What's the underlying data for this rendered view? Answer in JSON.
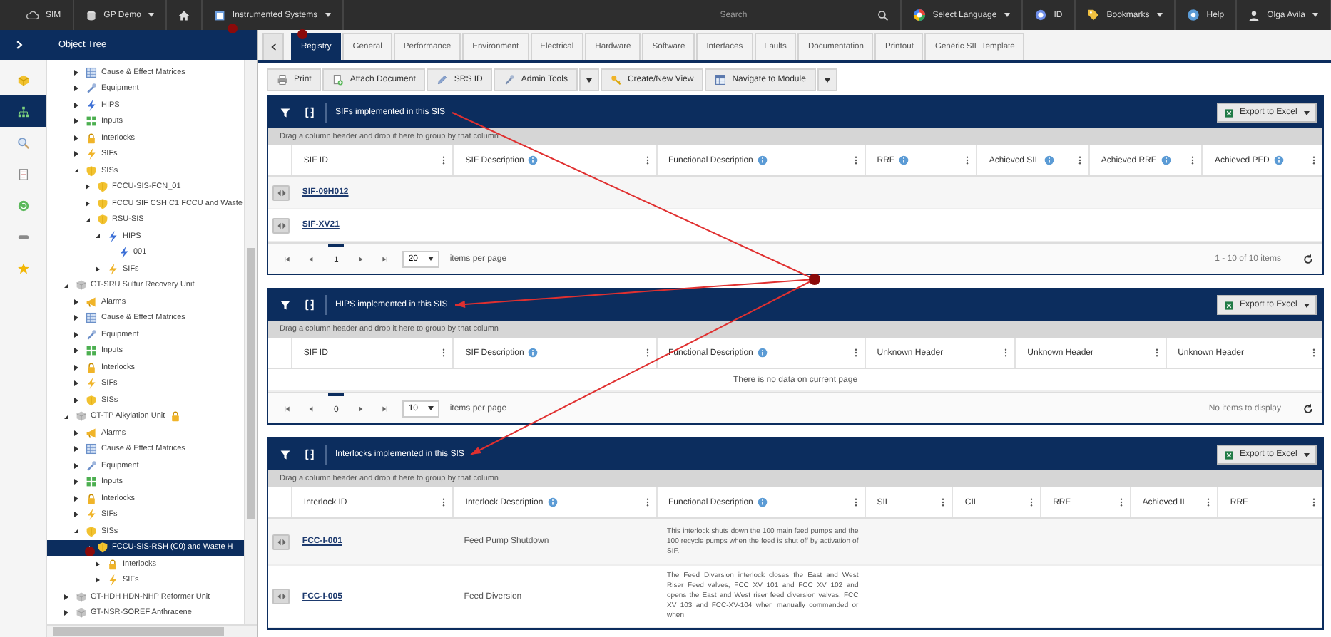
{
  "top_bar": {
    "app": "SIM",
    "site": "GP Demo",
    "module": "Instrumented Systems",
    "search": {
      "placeholder": "Search"
    },
    "language": "Select Language",
    "id_label": "ID",
    "bookmarks": "Bookmarks",
    "help": "Help",
    "user": "Olga Avila"
  },
  "rail": [
    {
      "kind": "cube",
      "selected": false
    },
    {
      "kind": "hierarchy",
      "selected": true
    },
    {
      "kind": "search",
      "selected": false
    },
    {
      "kind": "document",
      "selected": false
    },
    {
      "kind": "refresh",
      "selected": false
    },
    {
      "kind": "pill",
      "selected": false
    },
    {
      "kind": "star",
      "selected": false
    }
  ],
  "tree": {
    "title": "Object Tree",
    "continued": [
      {
        "label": "Cause & Effect Matrices",
        "kind": "matrix",
        "expanded": false
      },
      {
        "label": "Equipment",
        "kind": "wrench",
        "expanded": false
      },
      {
        "label": "HIPS",
        "kind": "hips",
        "expanded": false
      },
      {
        "label": "Inputs",
        "kind": "inputs",
        "expanded": false
      },
      {
        "label": "Interlocks",
        "kind": "lock",
        "expanded": false
      },
      {
        "label": "SIFs",
        "kind": "sif",
        "expanded": false
      },
      {
        "label": "SISs",
        "kind": "sis",
        "expanded": true,
        "children": [
          {
            "label": "FCCU-SIS-FCN_01",
            "kind": "sis",
            "expanded": false
          },
          {
            "label": "FCCU SIF CSH C1 FCCU and Waste",
            "kind": "sis",
            "expanded": false
          },
          {
            "label": "RSU-SIS",
            "kind": "sis",
            "expanded": true,
            "children": [
              {
                "label": "HIPS",
                "kind": "hips",
                "expanded": true,
                "children": [
                  {
                    "label": "001",
                    "kind": "hips"
                  }
                ]
              },
              {
                "label": "SIFs",
                "kind": "sif",
                "expanded": false
              }
            ]
          }
        ]
      }
    ],
    "items": [
      {
        "label": "GT-SRU Sulfur Recovery Unit",
        "kind": "cube",
        "expanded": true,
        "locked": false,
        "children": [
          {
            "label": "Alarms",
            "kind": "alarm",
            "expanded": false
          },
          {
            "label": "Cause & Effect Matrices",
            "kind": "matrix",
            "expanded": false
          },
          {
            "label": "Equipment",
            "kind": "wrench",
            "expanded": false
          },
          {
            "label": "Inputs",
            "kind": "inputs",
            "expanded": false
          },
          {
            "label": "Interlocks",
            "kind": "lock",
            "expanded": false
          },
          {
            "label": "SIFs",
            "kind": "sif",
            "expanded": false
          },
          {
            "label": "SISs",
            "kind": "sis",
            "expanded": false
          }
        ]
      },
      {
        "label": "GT-TP Alkylation Unit",
        "kind": "cube",
        "expanded": true,
        "locked": true,
        "children": [
          {
            "label": "Alarms",
            "kind": "alarm",
            "expanded": false
          },
          {
            "label": "Cause & Effect Matrices",
            "kind": "matrix",
            "expanded": false
          },
          {
            "label": "Equipment",
            "kind": "wrench",
            "expanded": false
          },
          {
            "label": "Inputs",
            "kind": "inputs",
            "expanded": false
          },
          {
            "label": "Interlocks",
            "kind": "lock",
            "expanded": false
          },
          {
            "label": "SIFs",
            "kind": "sif",
            "expanded": false
          },
          {
            "label": "SISs",
            "kind": "sis",
            "expanded": true,
            "children": [
              {
                "label": "FCCU-SIS-RSH (C0) and Waste H",
                "kind": "sis",
                "expanded": true,
                "selected": true,
                "children": [
                  {
                    "label": "Interlocks",
                    "kind": "lock",
                    "expanded": false
                  },
                  {
                    "label": "SIFs",
                    "kind": "sif",
                    "expanded": false
                  }
                ]
              }
            ]
          }
        ]
      },
      {
        "label": "GT-HDH HDN-NHP Reformer Unit",
        "kind": "cube",
        "expanded": false,
        "locked": false
      },
      {
        "label": "GT-NSR-SOREF Anthracene",
        "kind": "cube",
        "expanded": false,
        "locked": false
      }
    ]
  },
  "tabs": [
    {
      "label": "Registry",
      "selected": true
    },
    {
      "label": "General",
      "selected": false
    },
    {
      "label": "Performance",
      "selected": false
    },
    {
      "label": "Environment",
      "selected": false
    },
    {
      "label": "Electrical",
      "selected": false
    },
    {
      "label": "Hardware",
      "selected": false
    },
    {
      "label": "Software",
      "selected": false
    },
    {
      "label": "Interfaces",
      "selected": false
    },
    {
      "label": "Faults",
      "selected": false
    },
    {
      "label": "Documentation",
      "selected": false
    },
    {
      "label": "Printout",
      "selected": false
    },
    {
      "label": "Generic SIF Template",
      "selected": false
    }
  ],
  "toolbar": [
    {
      "label": "Print",
      "kind": "printer",
      "menu": false
    },
    {
      "label": "Attach Document",
      "kind": "attach",
      "menu": false
    },
    {
      "label": "SRS ID",
      "kind": "pen",
      "menu": false
    },
    {
      "label": "Admin Tools",
      "kind": "wrench",
      "menu": true
    },
    {
      "label": "Create/New View",
      "kind": "key",
      "menu": false
    },
    {
      "label": "Navigate to Module",
      "kind": "table",
      "menu": true
    }
  ],
  "grids": [
    {
      "title": "SIFs implemented in this SIS",
      "export": "Export to Excel",
      "group_hint": "Drag a column header and drop it here to group by that column",
      "columns": [
        {
          "label": "SIF ID",
          "info": false
        },
        {
          "label": "SIF Description",
          "info": true
        },
        {
          "label": "Functional Description",
          "info": true
        },
        {
          "label": "RRF",
          "info": true
        },
        {
          "label": "Achieved SIL",
          "info": true
        },
        {
          "label": "Achieved RRF",
          "info": true
        },
        {
          "label": "Achieved PFD",
          "info": true
        }
      ],
      "rows": [
        {
          "id": "SIF-09H012"
        },
        {
          "id": "SIF-XV21"
        }
      ],
      "pager": {
        "page": "1",
        "page_size": "20",
        "per_page": "items per page",
        "summary": "1 - 10 of 10 items"
      }
    },
    {
      "title": "HIPS implemented in this SIS",
      "export": "Export to Excel",
      "group_hint": "Drag a column header and drop it here to group by that column",
      "columns": [
        {
          "label": "SIF ID",
          "info": false
        },
        {
          "label": "SIF Description",
          "info": true
        },
        {
          "label": "Functional Description",
          "info": true
        },
        {
          "label": "Unknown Header",
          "info": false
        },
        {
          "label": "Unknown Header",
          "info": false
        },
        {
          "label": "Unknown Header",
          "info": false
        }
      ],
      "empty": "There is no data on current page",
      "pager": {
        "page": "0",
        "page_size": "10",
        "per_page": "items per page",
        "summary": "No items to display"
      }
    },
    {
      "title": "Interlocks implemented in this SIS",
      "export": "Export to Excel",
      "group_hint": "Drag a column header and drop it here to group by that column",
      "columns": [
        {
          "label": "Interlock ID",
          "info": false
        },
        {
          "label": "Interlock Description",
          "info": true
        },
        {
          "label": "Functional Description",
          "info": true
        },
        {
          "label": "SIL",
          "info": false
        },
        {
          "label": "CIL",
          "info": false
        },
        {
          "label": "RRF",
          "info": false
        },
        {
          "label": "Achieved IL",
          "info": false
        },
        {
          "label": "RRF",
          "info": false
        }
      ],
      "rows": [
        {
          "id": "FCC-I-001",
          "description": "Feed Pump Shutdown",
          "functional_description": "This interlock shuts down the 100 main feed pumps and the 100 recycle pumps when the feed is shut off by activation of SIF."
        },
        {
          "id": "FCC-I-005",
          "description": "Feed Diversion",
          "functional_description": "The Feed Diversion interlock closes the East and West Riser Feed valves, FCC XV 101 and FCC XV 102 and opens the East and West riser feed diversion valves, FCC XV 103 and FCC-XV-104 when manually commanded or when"
        }
      ]
    }
  ]
}
